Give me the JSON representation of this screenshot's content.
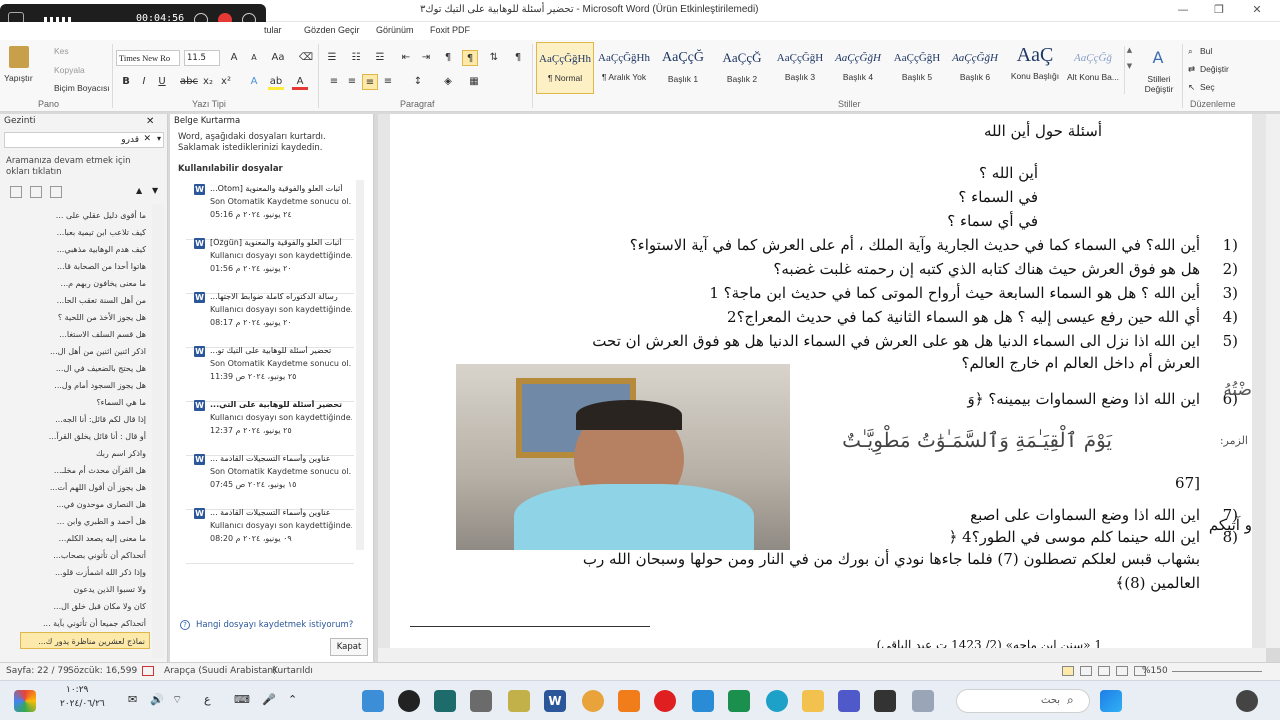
{
  "window": {
    "title": "تحضير أسئلة للوهابية على التيك توك٣ - Microsoft Word (Ürün Etkinleştirilemedi)",
    "controls": [
      "—",
      "❐",
      "✕"
    ]
  },
  "recorder": {
    "time": "00:04:56"
  },
  "tabs": [
    "tular",
    "Gözden Geçir",
    "Görünüm",
    "Foxit PDF"
  ],
  "ribbon": {
    "clipboard": {
      "paste": "Yapıştır",
      "cut": "Kes",
      "copy": "Kopyala",
      "painter": "Biçim Boyacısı",
      "label": "Pano"
    },
    "font": {
      "name": "Times New Ro",
      "size": "11.5",
      "label": "Yazı Tipi"
    },
    "paragraph": {
      "label": "Paragraf"
    },
    "styles": {
      "label": "Stiller",
      "items": [
        {
          "sample": "AaÇçĞğHh",
          "name": "¶ Normal"
        },
        {
          "sample": "AaÇçĞğHh",
          "name": "¶ Aralık Yok"
        },
        {
          "sample": "AaÇçĞ",
          "name": "Başlık 1"
        },
        {
          "sample": "AaÇçĞ",
          "name": "Başlık 2"
        },
        {
          "sample": "AaÇçĞğH",
          "name": "Başlık 3"
        },
        {
          "sample": "AaÇçĞğH",
          "name": "Başlık 4"
        },
        {
          "sample": "AaÇçĞğH",
          "name": "Başlık 5"
        },
        {
          "sample": "AaÇçĞğH",
          "name": "Başlık 6"
        },
        {
          "sample": "AaÇ",
          "name": "Konu Başlığı"
        },
        {
          "sample": "AaÇçĞğ",
          "name": "Alt Konu Ba..."
        }
      ],
      "change": "Stilleri Değiştir"
    },
    "editing": {
      "find": "Bul",
      "replace": "Değiştir",
      "select": "Seç",
      "label": "Düzenleme"
    }
  },
  "navigation": {
    "title": "Gezinti",
    "search_value": "قدرو",
    "message": "Aramanıza devam etmek için okları tıklatın",
    "items": [
      "ما أقوى دليل عقلي على ...",
      "كيف تلاعب ابن تيمية بعبا...",
      "كيف هدم الوهابية مذهبي...",
      "هاتوا أحدا من الصحابة قا...",
      "ما معنى يخافون ربهم م...",
      "من أهل السنة تعقب الحا...",
      "هل يجوز الأخذ من اللحية ؟",
      "هل قسم السلف الاستغا...",
      "اذكر اثنين اثنين من أهل ال...",
      "هل يحتج بالضعيف في ال...",
      "هل يجوز السجود أمام ول...",
      "ما هي السماء؟",
      "إذا قال لكم قائل: أنا الجه...",
      "أو قال : أنا قائل يخلق القرآ...",
      "واذكر اسم ربك",
      "هل القرآن محدث أم مخلـ...",
      "هل يجوز أن أقول اللهم أت...",
      "هل النصارى موحدون في...",
      "هل أحمد و الطبري وابن ...",
      "ما معنى إليه يصعد الكلم...",
      "أتحداكم أن تأتوني بصحاب...",
      "وإذا ذكر الله اشمأزت قلو...",
      "ولا تسبوا الذين يدعون",
      "كان ولا مكان قبل خلق ال...",
      "أتحداكم جميعا أن تأتوني بآية ...",
      "نماذج لعشرين مناظرة يدور ك..."
    ]
  },
  "recovery": {
    "title": "Belge Kurtarma",
    "intro": "Word, aşağıdaki dosyaları kurtardı. Saklamak istediklerinizi kaydedin.",
    "section": "Kullanılabilir dosyalar",
    "files": [
      {
        "name": "أثبات العلو والفوقية والمعنوية [Otom...",
        "desc": "Son Otomatik Kaydetme sonucu ol...",
        "time": "٢٤ يونيو، ٢٠٢٤ م 05:16"
      },
      {
        "name": "أثبات العلو والفوقية والمعنوية [Özgün]",
        "desc": "Kullanıcı dosyayı son kaydettiğinde...",
        "time": "٢٠ يونيو، ٢٠٢٤ م 01:56"
      },
      {
        "name": "رسالة الدكتوراه كاملة ضوابط الاجتها...",
        "desc": "Kullanıcı dosyayı son kaydettiğinde...",
        "time": "٢٠ يونيو، ٢٠٢٤ م 08:17"
      },
      {
        "name": "تحضير أسئلة للوهابية على التيك تو...",
        "desc": "Son Otomatik Kaydetme sonucu ol...",
        "time": "٢٥ يونيو، ٢٠٢٤ ص 11:39"
      },
      {
        "name": "تحضير أسئلة للوهابية على التي...",
        "desc": "Kullanıcı dosyayı son kaydettiğinde...",
        "time": "٢٥ يونيو، ٢٠٢٤ م 12:37"
      },
      {
        "name": "عناوين وأسماء التسجيلات القادمة ...",
        "desc": "Son Otomatik Kaydetme sonucu ol...",
        "time": "١٥ يونيو، ٢٠٢٤ ص 07:45"
      },
      {
        "name": "عناوين وأسماء التسجيلات القادمة ...",
        "desc": "Kullanıcı dosyayı son kaydettiğinde...",
        "time": "٠٩ يونيو، ٢٠٢٤ م 08:20"
      }
    ],
    "help": "Hangi dosyayı kaydetmek istiyorum?",
    "close": "Kapat"
  },
  "document": {
    "heading": "أسئلة حول أين الله",
    "intro": [
      "أين الله ؟",
      "في السماء ؟",
      "في أي سماء ؟"
    ],
    "items": [
      {
        "n": "1)",
        "text": "أين الله؟ في السماء كما في حديث الجارية وآية الملك ، أم على العرش كما في آية الاستواء؟"
      },
      {
        "n": "2)",
        "text": "هل هو فوق العرش حيث هناك كتابه الذي كتبه إن رحمته غلبت غضبه؟"
      },
      {
        "n": "3)",
        "text": "أين الله ؟ هل هو السماء السابعة حيث أرواح الموتى كما في حديث ابن ماجة؟ 1"
      },
      {
        "n": "4)",
        "text": "أي الله حين رفع عيسى إليه ؟ هل هو السماء الثانية كما في حديث المعراج؟2"
      },
      {
        "n": "5)",
        "text": "اين الله اذا نزل الى السماء الدنيا هل هو على العرش في السماء الدنيا هل هو فوق العرش ان تحت"
      },
      {
        "n": "",
        "text": "العرش أم داخل العالم ام خارج العالم؟"
      },
      {
        "n": "6)",
        "text": "اين الله اذا وضع السماوات بيمينه؟ ﴿وَ"
      },
      {
        "n": "",
        "text": "يَوْمَ ٱلْقِيَـٰمَةِ وَٱلسَّمَـٰوَٰتُ مَطْوِيَّـٰتٌ"
      },
      {
        "n": "",
        "text": "[67"
      },
      {
        "n": "7)",
        "text": "اين الله اذا وضع السماوات على اصبع"
      },
      {
        "n": "8)",
        "text": "اين الله حينما كلم موسى في الطور؟4 ﴿"
      },
      {
        "n": "",
        "text": "بشهاب قبس لعلكم تصطلون (7) فلما جاءها نودي أن بورك من في النار ومن حولها وسبحان الله رب"
      },
      {
        "n": "",
        "text": "العالمين (8)﴾"
      }
    ],
    "side_fragments": {
      "right6": "ضْتُهُ",
      "zumar": "الزمر:",
      "right8": "و آتيكم"
    },
    "footnote": "1 «سنن ابن ماجه» (2/ 1423 ت عبد الباقي)"
  },
  "status": {
    "page": "Sayfa: 22 / 79",
    "words": "Sözcük: 16,599",
    "lang": "Arapça (Suudi Arabistan)",
    "recovered": "Kurtarıldı",
    "zoom": "%150"
  },
  "taskbar": {
    "time": "١٠:٢٩",
    "date": "٢٠٢٤/٠٦/٢٦",
    "search": "بحث",
    "lang": "ع"
  }
}
